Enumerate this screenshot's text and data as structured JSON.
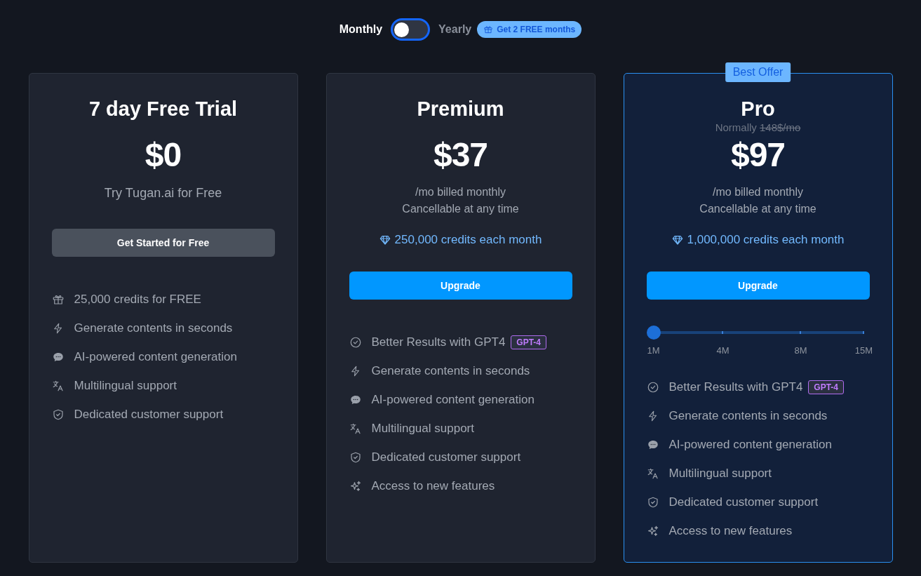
{
  "billing": {
    "options": [
      {
        "label": "Monthly",
        "selected": true
      },
      {
        "label": "Yearly",
        "selected": false
      }
    ],
    "promo": "Get 2 FREE months"
  },
  "plans": [
    {
      "name": "7 day Free Trial",
      "highlighted": false,
      "price": "$0",
      "tagline": "Try Tugan.ai for Free",
      "button": {
        "label": "Get Started for Free",
        "kind": "secondary"
      },
      "features": [
        {
          "kind": "gift",
          "text": "25,000 credits for FREE"
        },
        {
          "kind": "bolt",
          "text": "Generate contents in seconds"
        },
        {
          "kind": "chat",
          "text": "AI-powered content generation"
        },
        {
          "kind": "translate",
          "text": "Multilingual support"
        },
        {
          "kind": "shield",
          "text": "Dedicated customer support"
        }
      ]
    },
    {
      "name": "Premium",
      "highlighted": false,
      "price": "$37",
      "billing_lines": [
        "/mo billed monthly",
        "Cancellable at any time"
      ],
      "credits": "250,000 credits each month",
      "button": {
        "label": "Upgrade",
        "kind": "primary"
      },
      "features": [
        {
          "kind": "check",
          "text": "Better Results with GPT4",
          "tag": "GPT-4"
        },
        {
          "kind": "bolt",
          "text": "Generate contents in seconds"
        },
        {
          "kind": "chat",
          "text": "AI-powered content generation"
        },
        {
          "kind": "translate",
          "text": "Multilingual support"
        },
        {
          "kind": "shield",
          "text": "Dedicated customer support"
        },
        {
          "kind": "sparkle",
          "text": "Access to new features"
        }
      ]
    },
    {
      "name": "Pro",
      "highlighted": true,
      "badge": "Best Offer",
      "normally": "Normally",
      "old_price": "148$/mo",
      "price": "$97",
      "billing_lines": [
        "/mo billed monthly",
        "Cancellable at any time"
      ],
      "credits": "1,000,000 credits each month",
      "button": {
        "label": "Upgrade",
        "kind": "primary"
      },
      "slider": {
        "level": 0,
        "ticks": [
          "1M",
          "4M",
          "8M",
          "15M"
        ]
      },
      "features": [
        {
          "kind": "check",
          "text": "Better Results with GPT4",
          "tag": "GPT-4"
        },
        {
          "kind": "bolt",
          "text": "Generate contents in seconds"
        },
        {
          "kind": "chat",
          "text": "AI-powered content generation"
        },
        {
          "kind": "translate",
          "text": "Multilingual support"
        },
        {
          "kind": "shield",
          "text": "Dedicated customer support"
        },
        {
          "kind": "sparkle",
          "text": "Access to new features"
        }
      ]
    }
  ]
}
